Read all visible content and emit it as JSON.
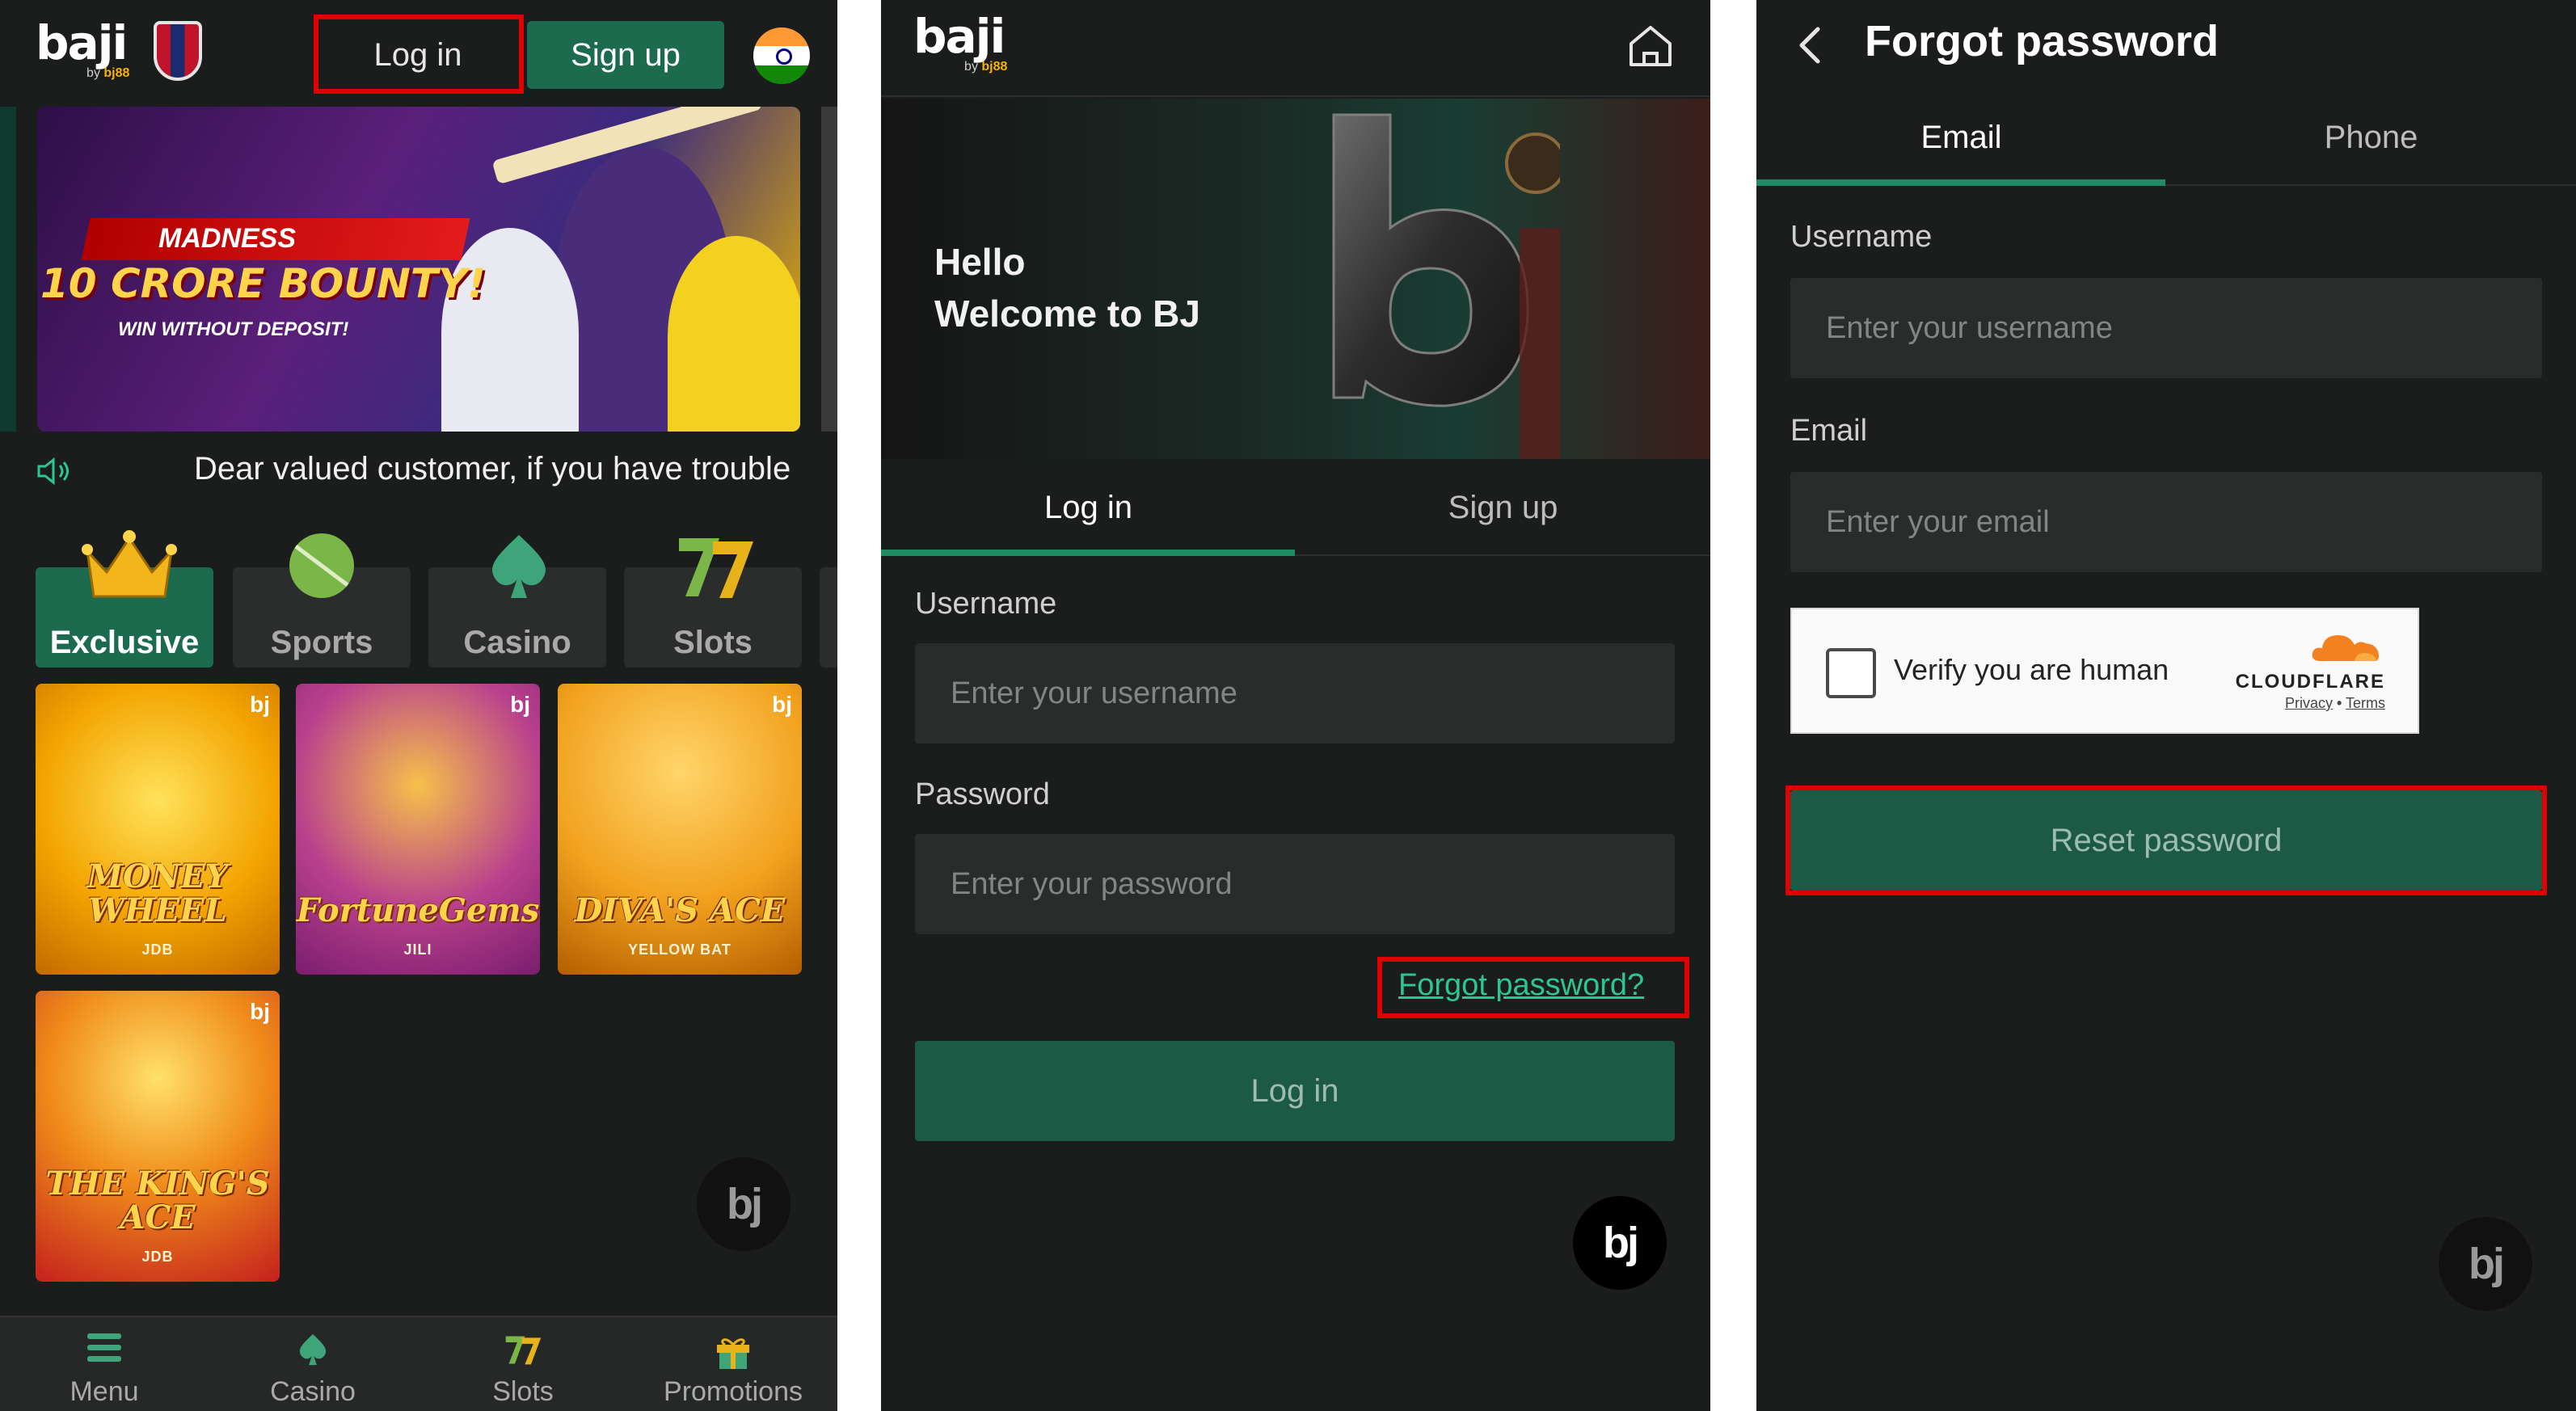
{
  "panel1": {
    "logo": {
      "word": "baji",
      "by_prefix": "by",
      "by_brand": "bj88"
    },
    "header": {
      "login_label": "Log in",
      "signup_label": "Sign up"
    },
    "banner": {
      "madness_text": "MADNESS",
      "bounty_text": "10 CRORE BOUNTY!",
      "win_text": "WIN WITHOUT DEPOSIT!",
      "active_slide": 1,
      "slide_count": 9
    },
    "marquee_text": "Dear valued customer, if you have trouble",
    "categories": [
      {
        "label": "Exclusive",
        "icon": "crown-icon"
      },
      {
        "label": "Sports",
        "icon": "cricket-ball-icon"
      },
      {
        "label": "Casino",
        "icon": "spade-icon"
      },
      {
        "label": "Slots",
        "icon": "slot-seven-icon"
      }
    ],
    "games": [
      {
        "title": "MONEY WHEEL",
        "provider": "JDB",
        "badge": "bj"
      },
      {
        "title": "FortuneGems",
        "provider": "JILI",
        "badge": "bj"
      },
      {
        "title": "DIVA'S ACE",
        "provider": "YELLOW BAT",
        "badge": "bj"
      },
      {
        "title": "THE KING'S ACE",
        "provider": "JDB",
        "badge": "bj"
      }
    ],
    "chat_label": "bj",
    "tabbar": [
      {
        "label": "Menu",
        "icon": "menu-icon"
      },
      {
        "label": "Casino",
        "icon": "spade-icon"
      },
      {
        "label": "Slots",
        "icon": "slot-seven-icon"
      },
      {
        "label": "Promotions",
        "icon": "gift-icon"
      }
    ]
  },
  "panel2": {
    "logo": {
      "word": "baji",
      "by_prefix": "by",
      "by_brand": "bj88"
    },
    "hero": {
      "line1": "Hello",
      "line2": "Welcome to BJ"
    },
    "tabs": [
      {
        "label": "Log in"
      },
      {
        "label": "Sign up"
      }
    ],
    "username_label": "Username",
    "username_placeholder": "Enter your username",
    "password_label": "Password",
    "password_placeholder": "Enter your password",
    "forgot_label": "Forgot password?",
    "login_button": "Log in",
    "chat_label": "bj"
  },
  "panel3": {
    "title": "Forgot password",
    "tabs": [
      {
        "label": "Email"
      },
      {
        "label": "Phone"
      }
    ],
    "username_label": "Username",
    "username_placeholder": "Enter your username",
    "email_label": "Email",
    "email_placeholder": "Enter your email",
    "captcha": {
      "text": "Verify you are human",
      "brand": "CLOUDFLARE",
      "privacy": "Privacy",
      "terms": "Terms",
      "separator": "•"
    },
    "reset_button": "Reset password",
    "chat_label": "bj"
  },
  "colors": {
    "background": "#1b1c1c",
    "accent_green": "#1d6b4f",
    "link_green": "#2cc68f",
    "highlight_red": "#e00000"
  }
}
